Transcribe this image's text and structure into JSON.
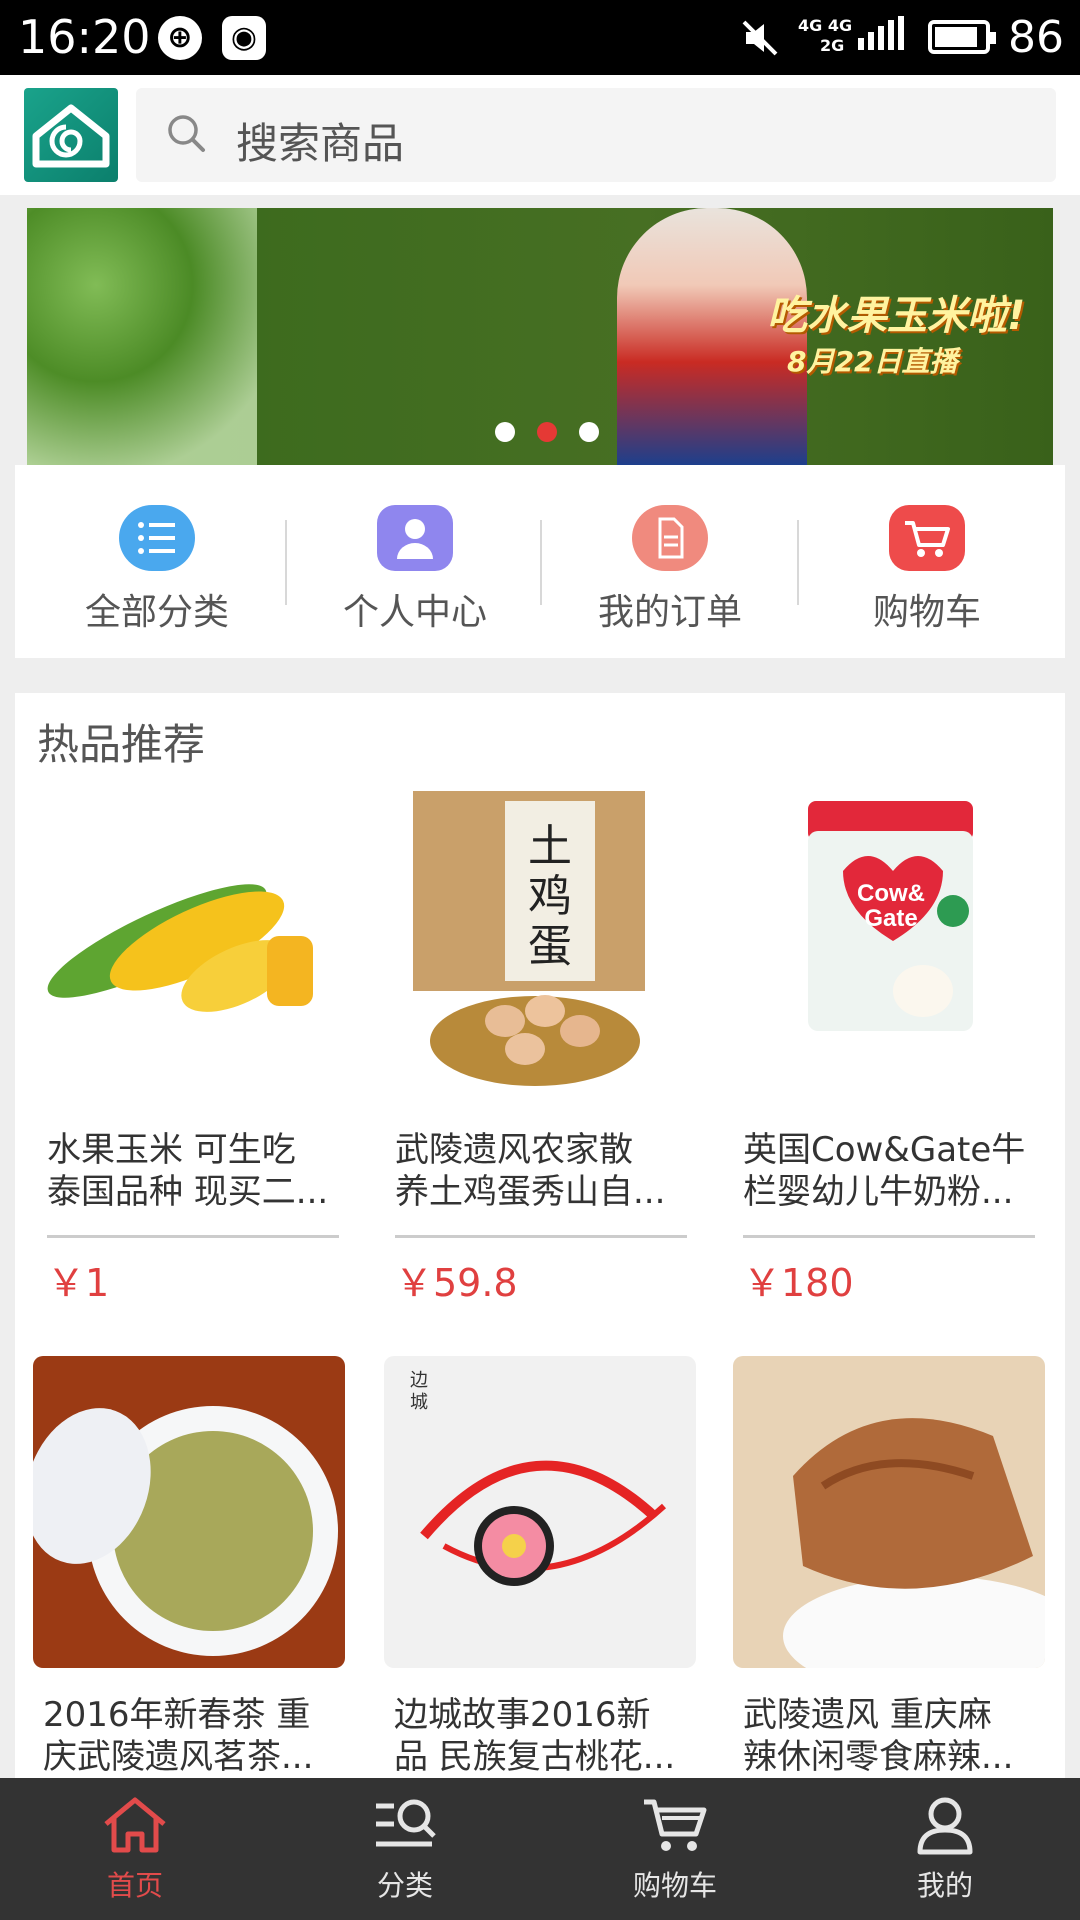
{
  "status_bar": {
    "time": "16:20",
    "network_top": "4G 4G",
    "network_bottom": "2G",
    "battery_percent": "86"
  },
  "header": {
    "search_placeholder": "搜索商品"
  },
  "banner": {
    "headline": "吃水果玉米啦!",
    "subline": "8月22日直播",
    "slide_count": 3,
    "active_slide": 2
  },
  "quick_nav": [
    {
      "label": "全部分类",
      "icon": "list-icon",
      "color": "#4aa8ee"
    },
    {
      "label": "个人中心",
      "icon": "person-icon",
      "color": "#8f86ee"
    },
    {
      "label": "我的订单",
      "icon": "document-icon",
      "color": "#f08a7e"
    },
    {
      "label": "购物车",
      "icon": "cart-icon",
      "color": "#ee4b4b"
    }
  ],
  "hot": {
    "title": "热品推荐",
    "products": [
      {
        "line1": "水果玉米 可生吃",
        "line2": "泰国品种 现买二...",
        "price": "￥1",
        "image": "corn-image"
      },
      {
        "line1": "武陵遗风农家散",
        "line2": "养土鸡蛋秀山自...",
        "price": "￥59.8",
        "image": "egg-box-image"
      },
      {
        "line1": "英国Cow&Gate牛",
        "line2": "栏婴幼儿牛奶粉...",
        "price": "￥180",
        "image": "milk-powder-image"
      },
      {
        "line1": "2016年新春茶 重",
        "line2": "庆武陵遗风茗茶...",
        "price": "",
        "image": "tea-cup-image"
      },
      {
        "line1": "边城故事2016新",
        "line2": "品 民族复古桃花...",
        "price": "",
        "image": "bracelet-image"
      },
      {
        "line1": "武陵遗风 重庆麻",
        "line2": "辣休闲零食麻辣...",
        "price": "",
        "image": "spicy-snack-image"
      }
    ]
  },
  "tabbar": {
    "items": [
      {
        "label": "首页",
        "icon": "home-icon",
        "active": true
      },
      {
        "label": "分类",
        "icon": "category-search-icon",
        "active": false
      },
      {
        "label": "购物车",
        "icon": "cart-icon",
        "active": false
      },
      {
        "label": "我的",
        "icon": "user-icon",
        "active": false
      }
    ]
  },
  "colors": {
    "accent_red": "#e24b4b",
    "price_red": "#e04040",
    "logo_green": "#1aa38b",
    "tabbar_bg": "#333333"
  }
}
